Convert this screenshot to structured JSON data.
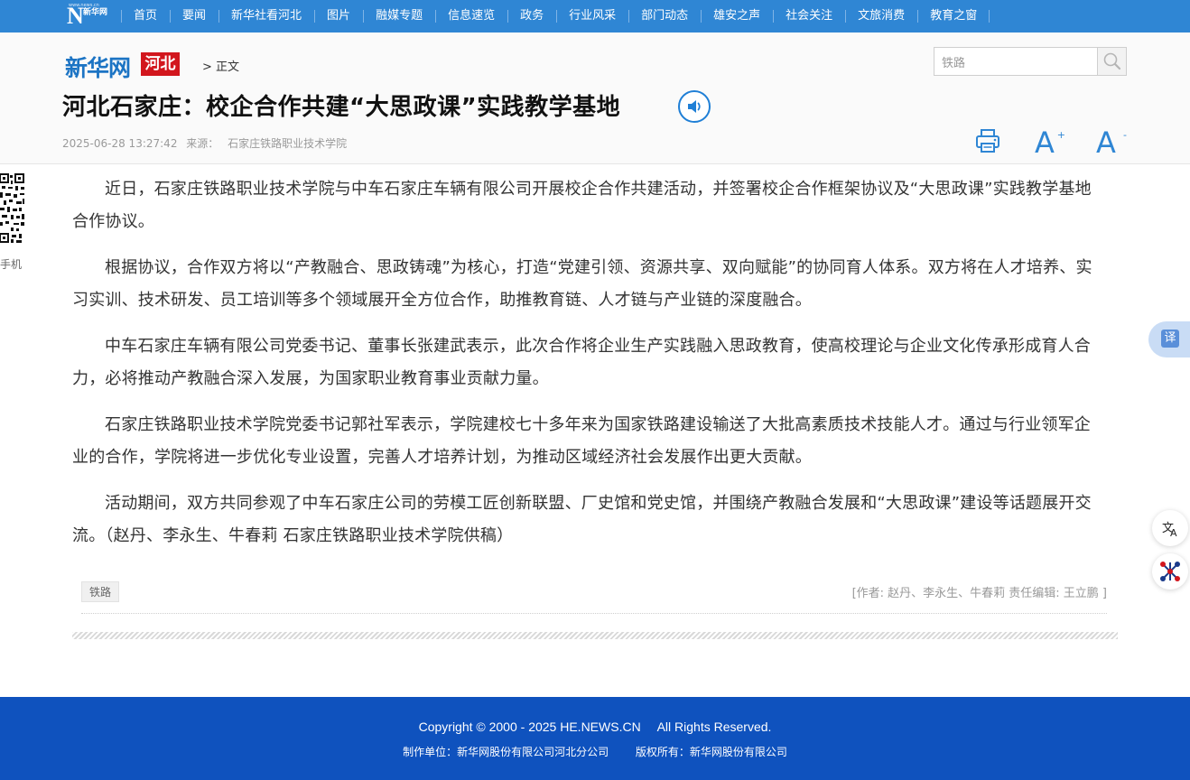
{
  "nav": {
    "logo_text": "N",
    "logo_sub": "新华网",
    "logo_tiny": "www.news.cn",
    "items": [
      "首页",
      "要闻",
      "新华社看河北",
      "图片",
      "融媒专题",
      "信息速览",
      "政务",
      "行业风采",
      "部门动态",
      "雄安之声",
      "社会关注",
      "文旅消费",
      "教育之窗"
    ]
  },
  "brand": {
    "name": "新华网",
    "region": "河北"
  },
  "breadcrumb": "> 正文",
  "search": {
    "value": "铁路"
  },
  "article": {
    "title": "河北石家庄：校企合作共建“大思政课”实践教学基地",
    "datetime": "2025-06-28 13:27:42",
    "source_label": "来源：",
    "source": "石家庄铁路职业技术学院",
    "paragraphs": [
      "近日，石家庄铁路职业技术学院与中车石家庄车辆有限公司开展校企合作共建活动，并签署校企合作框架协议及“大思政课”实践教学基地合作协议。",
      "根据协议，合作双方将以“产教融合、思政铸魂”为核心，打造“党建引领、资源共享、双向赋能”的协同育人体系。双方将在人才培养、实习实训、技术研发、员工培训等多个领域展开全方位合作，助推教育链、人才链与产业链的深度融合。",
      "中车石家庄车辆有限公司党委书记、董事长张建武表示，此次合作将企业生产实践融入思政教育，使高校理论与企业文化传承形成育人合力，必将推动产教融合深入发展，为国家职业教育事业贡献力量。",
      "石家庄铁路职业技术学院党委书记郭社军表示，学院建校七十多年来为国家铁路建设输送了大批高素质技术技能人才。通过与行业领军企业的合作，学院将进一步优化专业设置，完善人才培养计划，为推动区域经济社会发展作出更大贡献。",
      "活动期间，双方共同参观了中车石家庄公司的劳模工匠创新联盟、厂史馆和党史馆，并围绕产教融合发展和“大思政课”建设等话题展开交流。（赵丹、李永生、牛春莉 石家庄铁路职业技术学院供稿）"
    ],
    "tag": "铁路",
    "credits": "[作者: 赵丹、李永生、牛春莉     责任编辑: 王立鹏 ]"
  },
  "tools": {
    "font_up": "A",
    "font_up_sup": "+",
    "font_down": "A",
    "font_down_sup": "-"
  },
  "side": {
    "qr_label": "手机",
    "translate": "译"
  },
  "footer": {
    "copyright": "Copyright © 2000 - 2025 HE.NEWS.CN",
    "rights": "All Rights Reserved.",
    "producer": "制作单位：新华网股份有限公司河北分公司",
    "owner": "版权所有：新华网股份有限公司"
  }
}
